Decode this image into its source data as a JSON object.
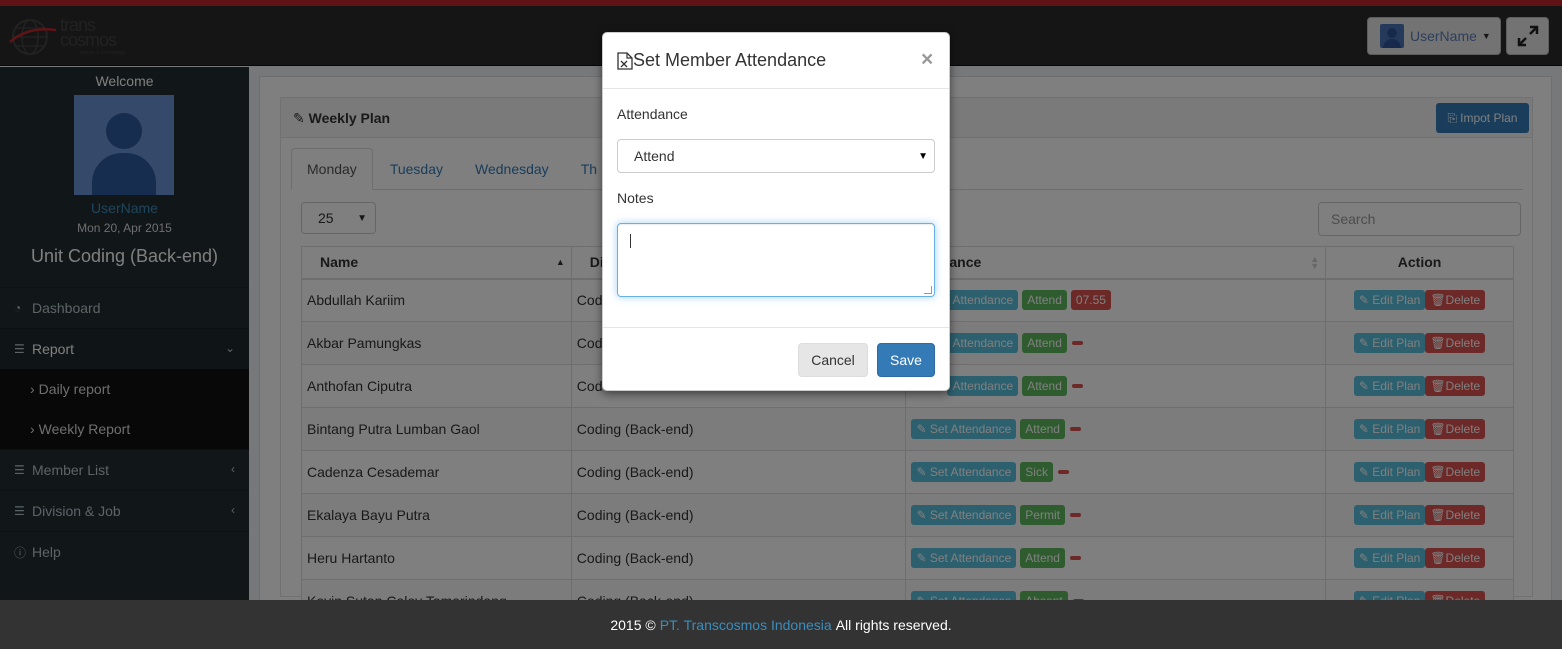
{
  "header": {
    "logo_text_line1": "trans",
    "logo_text_line2": "cosmos",
    "logo_tagline": "people & technology",
    "user_button": "UserName"
  },
  "sidebar": {
    "welcome": "Welcome",
    "username": "UserName",
    "date": "Mon 20, Apr 2015",
    "unit": "Unit Coding (Back-end)",
    "items": [
      {
        "label": "Dashboard",
        "icon": "dashboard-icon"
      },
      {
        "label": "Report",
        "icon": "list-icon"
      },
      {
        "label": "Daily report"
      },
      {
        "label": "Weekly Report"
      },
      {
        "label": "Member List",
        "icon": "list-icon"
      },
      {
        "label": "Division & Job",
        "icon": "list-icon"
      },
      {
        "label": "Help",
        "icon": "info-icon"
      }
    ]
  },
  "main": {
    "box_title": "Weekly Plan",
    "import_button": "Impot Plan",
    "tabs": [
      "Monday",
      "Tuesday",
      "Wednesday",
      "Th"
    ],
    "page_length": "25",
    "search_placeholder": "Search",
    "columns": [
      "Name",
      "Di",
      "endance",
      "Action"
    ],
    "rows": [
      {
        "name": "Abdullah Kariim",
        "division": "Cod",
        "status": "Attend",
        "time": "07.55"
      },
      {
        "name": "Akbar Pamungkas",
        "division": "Cod",
        "status": "Attend",
        "time": ""
      },
      {
        "name": "Anthofan Ciputra",
        "division": "Cod",
        "status": "Attend",
        "time": ""
      },
      {
        "name": "Bintang Putra Lumban Gaol",
        "division": "Coding (Back-end)",
        "status": "Attend",
        "time": ""
      },
      {
        "name": "Cadenza Cesademar",
        "division": "Coding (Back-end)",
        "status": "Sick",
        "time": ""
      },
      {
        "name": "Ekalaya Bayu Putra",
        "division": "Coding (Back-end)",
        "status": "Permit",
        "time": ""
      },
      {
        "name": "Heru Hartanto",
        "division": "Coding (Back-end)",
        "status": "Attend",
        "time": ""
      },
      {
        "name": "Kevin Sutan Caloy Tamarindang",
        "division": "Coding (Back-end)",
        "status": "Absent",
        "time": ""
      }
    ],
    "set_attendance_label": "Set Attendance",
    "set_attendance_partial": "Attendance",
    "edit_label": "Edit Plan",
    "delete_label": "Delete"
  },
  "modal": {
    "title": "Set Member Attendance",
    "close": "×",
    "attendance_label": "Attendance",
    "attendance_value": "Attend",
    "notes_label": "Notes",
    "cancel": "Cancel",
    "save": "Save"
  },
  "footer": {
    "year": "2015 ©",
    "company": "PT. Transcosmos Indonesia",
    "rights": "All rights reserved."
  }
}
